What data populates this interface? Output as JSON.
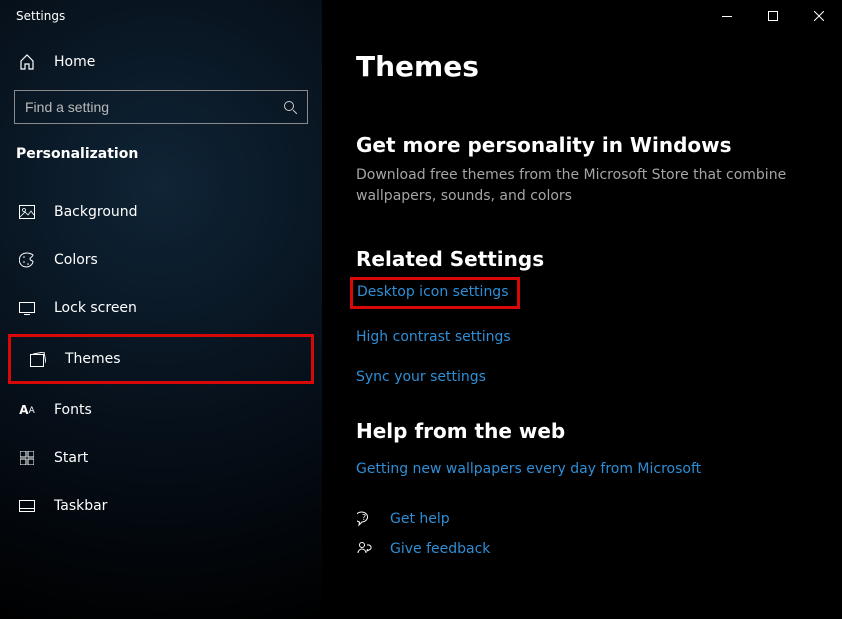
{
  "window": {
    "title": "Settings"
  },
  "sidebar": {
    "home": "Home",
    "search_placeholder": "Find a setting",
    "section": "Personalization",
    "items": [
      {
        "label": "Background"
      },
      {
        "label": "Colors"
      },
      {
        "label": "Lock screen"
      },
      {
        "label": "Themes"
      },
      {
        "label": "Fonts"
      },
      {
        "label": "Start"
      },
      {
        "label": "Taskbar"
      }
    ]
  },
  "main": {
    "title": "Themes",
    "more": {
      "heading": "Get more personality in Windows",
      "desc": "Download free themes from the Microsoft Store that combine wallpapers, sounds, and colors"
    },
    "related": {
      "heading": "Related Settings",
      "links": [
        "Desktop icon settings",
        "High contrast settings",
        "Sync your settings"
      ]
    },
    "help": {
      "heading": "Help from the web",
      "link": "Getting new wallpapers every day from Microsoft",
      "get_help": "Get help",
      "give_feedback": "Give feedback"
    }
  }
}
